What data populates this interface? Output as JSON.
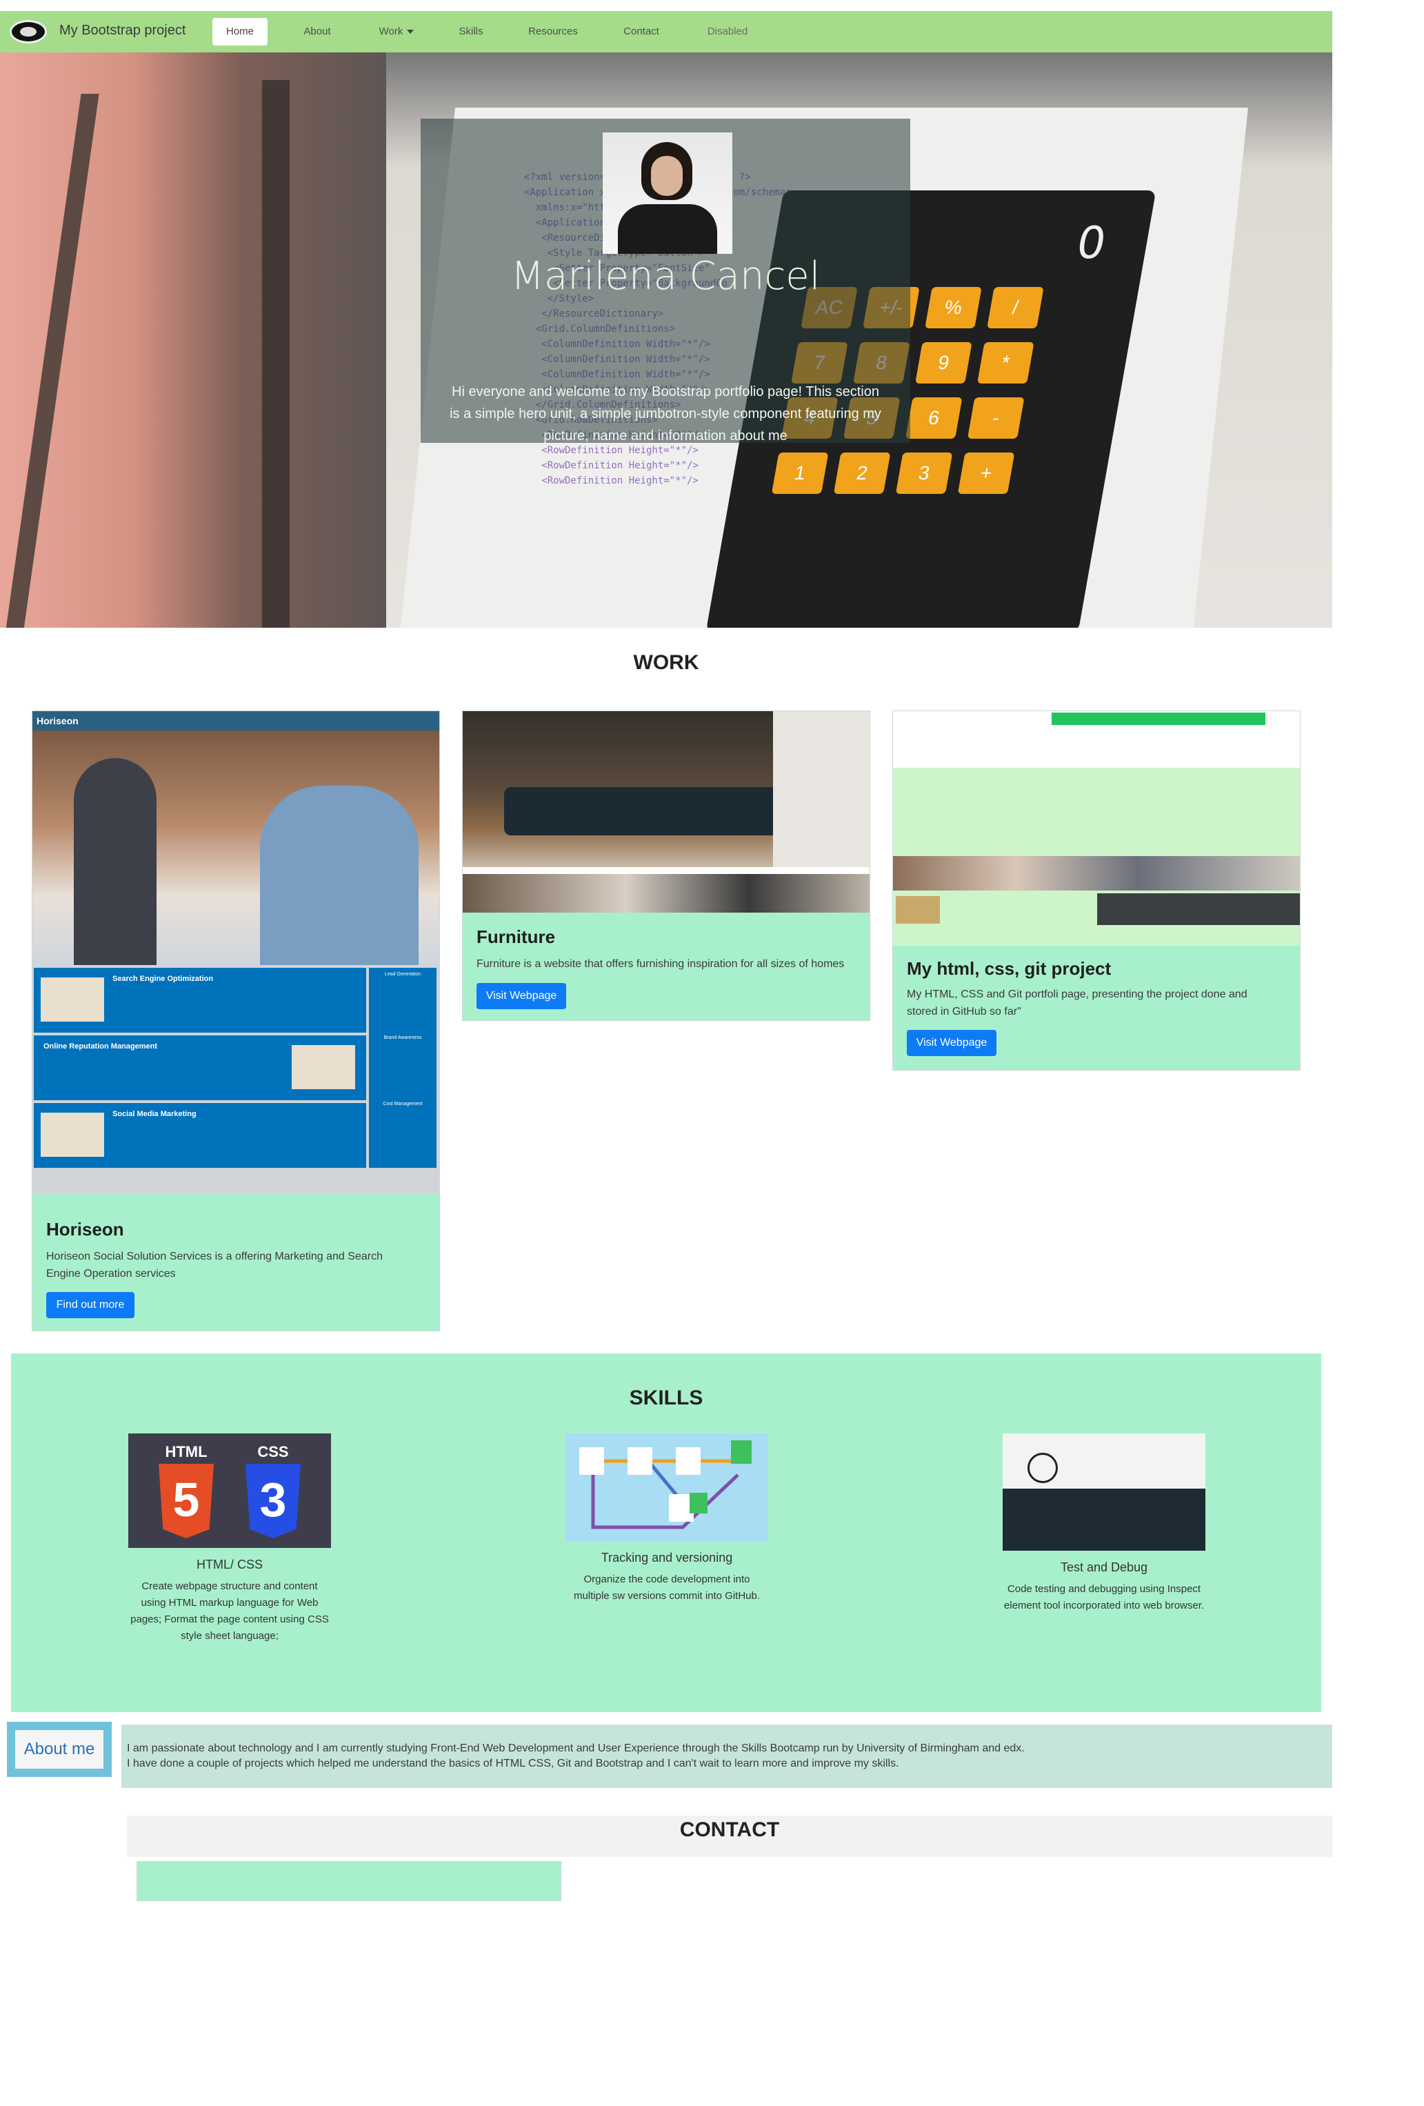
{
  "navbar": {
    "brand": "My Bootstrap project",
    "items": [
      {
        "label": "Home",
        "active": true
      },
      {
        "label": "About"
      },
      {
        "label": "Work"
      },
      {
        "label": "Skills"
      },
      {
        "label": "Resources"
      },
      {
        "label": "Contact"
      },
      {
        "label": "Disabled",
        "disabled": true
      }
    ],
    "bg_color": "#a4dc8a"
  },
  "hero": {
    "name": "Marilena Cancel",
    "text": "Hi everyone and welcome to my Bootstrap portfolio page! This section is a simple hero unit, a simple jumbotron-style component featuring my picture, name and information about me",
    "calc_display": "0",
    "calc_keys": [
      "AC",
      "+/-",
      "%",
      "/",
      "7",
      "8",
      "9",
      "*",
      "4",
      "5",
      "6",
      "-",
      "1",
      "2",
      "3",
      "+"
    ]
  },
  "work": {
    "title": "WORK",
    "cards": [
      {
        "title": "Horiseon",
        "text": "Horiseon Social Solution Services is a offering Marketing and Search Engine Operation services",
        "button": "Find out more",
        "thumb": {
          "brand": "Horiseon",
          "blocks": [
            "Search Engine Optimization",
            "Online Reputation Management",
            "Social Media Marketing"
          ],
          "side": [
            "Lead Generation",
            "Brand Awareness",
            "Cost Management"
          ]
        }
      },
      {
        "title": "Furniture",
        "text": "Furniture is a website that offers furnishing inspiration for all sizes of homes",
        "button": "Visit Webpage"
      },
      {
        "title": "My html, css, git project",
        "text": "My HTML, CSS and Git portfoli page, presenting the project done and stored in GitHub so far\"",
        "button": "Visit Webpage"
      }
    ]
  },
  "skills": {
    "title": "SKILLS",
    "items": [
      {
        "name": "HTML/ CSS",
        "desc": "Create webpage structure and content using HTML markup language for Web pages; Format the page content using CSS style sheet language;",
        "icon": "html-css-icon",
        "html_label": "HTML",
        "css_label": "CSS",
        "html_num": "5",
        "css_num": "3"
      },
      {
        "name": "Tracking and versioning",
        "desc": "Organize the code development into multiple sw versions commit into GitHub.",
        "icon": "git-graph-icon"
      },
      {
        "name": "Test and Debug",
        "desc": "Code testing and debugging using Inspect element tool incorporated into web browser.",
        "icon": "devtools-icon"
      }
    ],
    "bg_color": "#a8f0cc"
  },
  "about": {
    "button": "About me",
    "text_line1": "I am passionate about technology and I am currently studying Front-End Web Development and User Experience through the Skills Bootcamp run by University of Birmingham and edx.",
    "text_line2": "I have done a couple of projects which helped me understand the basics of HTML CSS, Git and Bootstrap and I can't wait to learn more and improve my skills."
  },
  "contact": {
    "title": "CONTACT"
  },
  "colors": {
    "accent_green": "#a8f0cc",
    "button_blue": "#0d7bf5",
    "about_border": "#6fc2d9"
  }
}
